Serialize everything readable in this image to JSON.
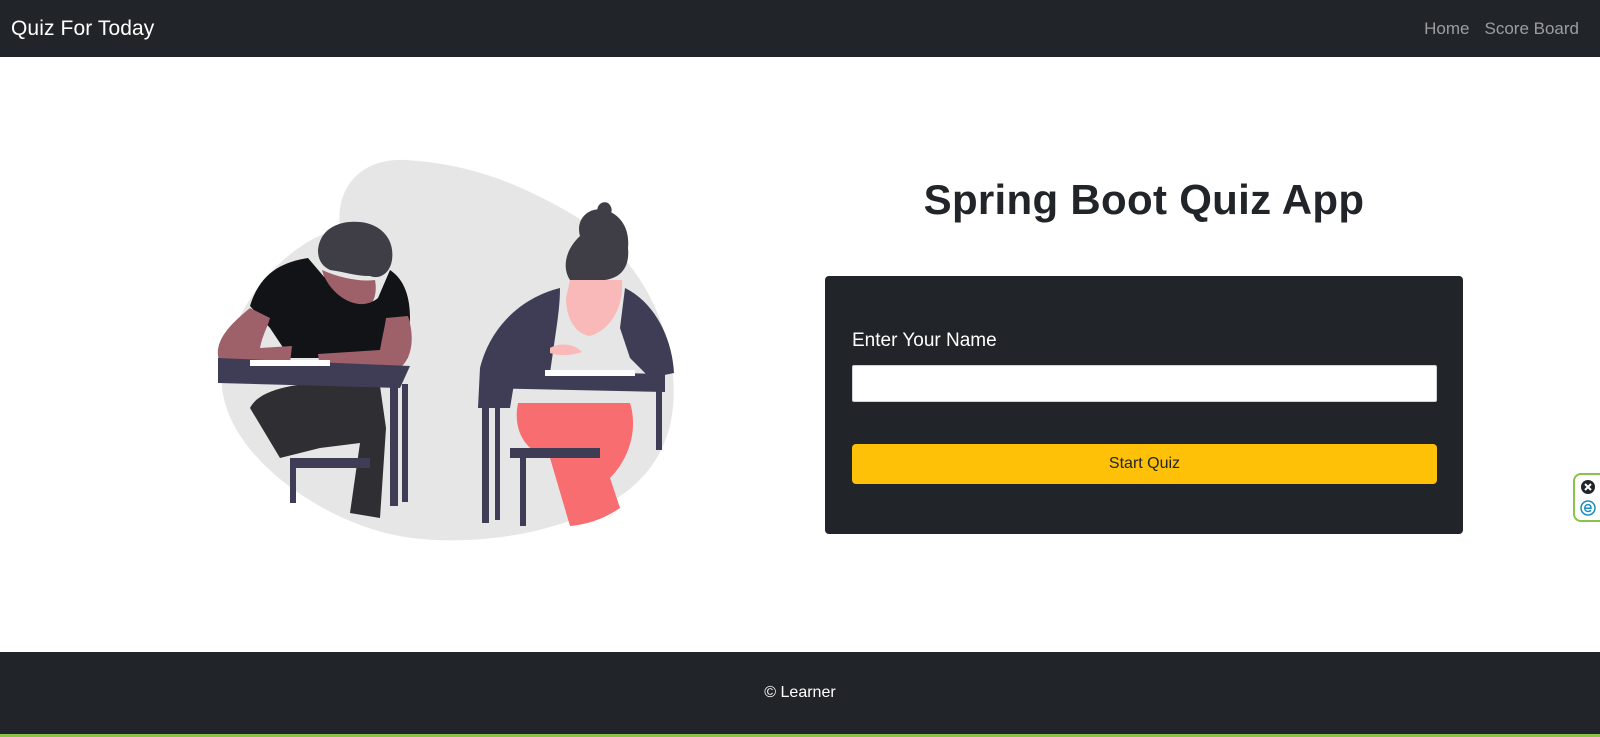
{
  "navbar": {
    "brand": "Quiz For Today",
    "links": [
      "Home",
      "Score Board"
    ]
  },
  "hero": {
    "title": "Spring Boot Quiz App"
  },
  "form": {
    "label": "Enter Your Name",
    "input_value": "",
    "input_placeholder": "",
    "button_label": "Start Quiz"
  },
  "footer": {
    "text": "© Learner"
  },
  "colors": {
    "dark": "#212529",
    "accent": "#ffc107",
    "widget_border": "#8bc34a"
  },
  "icons": {
    "illustration": "students-taking-exam-illustration",
    "widget_close": "close-circle-icon",
    "widget_app": "e-letter-icon"
  }
}
